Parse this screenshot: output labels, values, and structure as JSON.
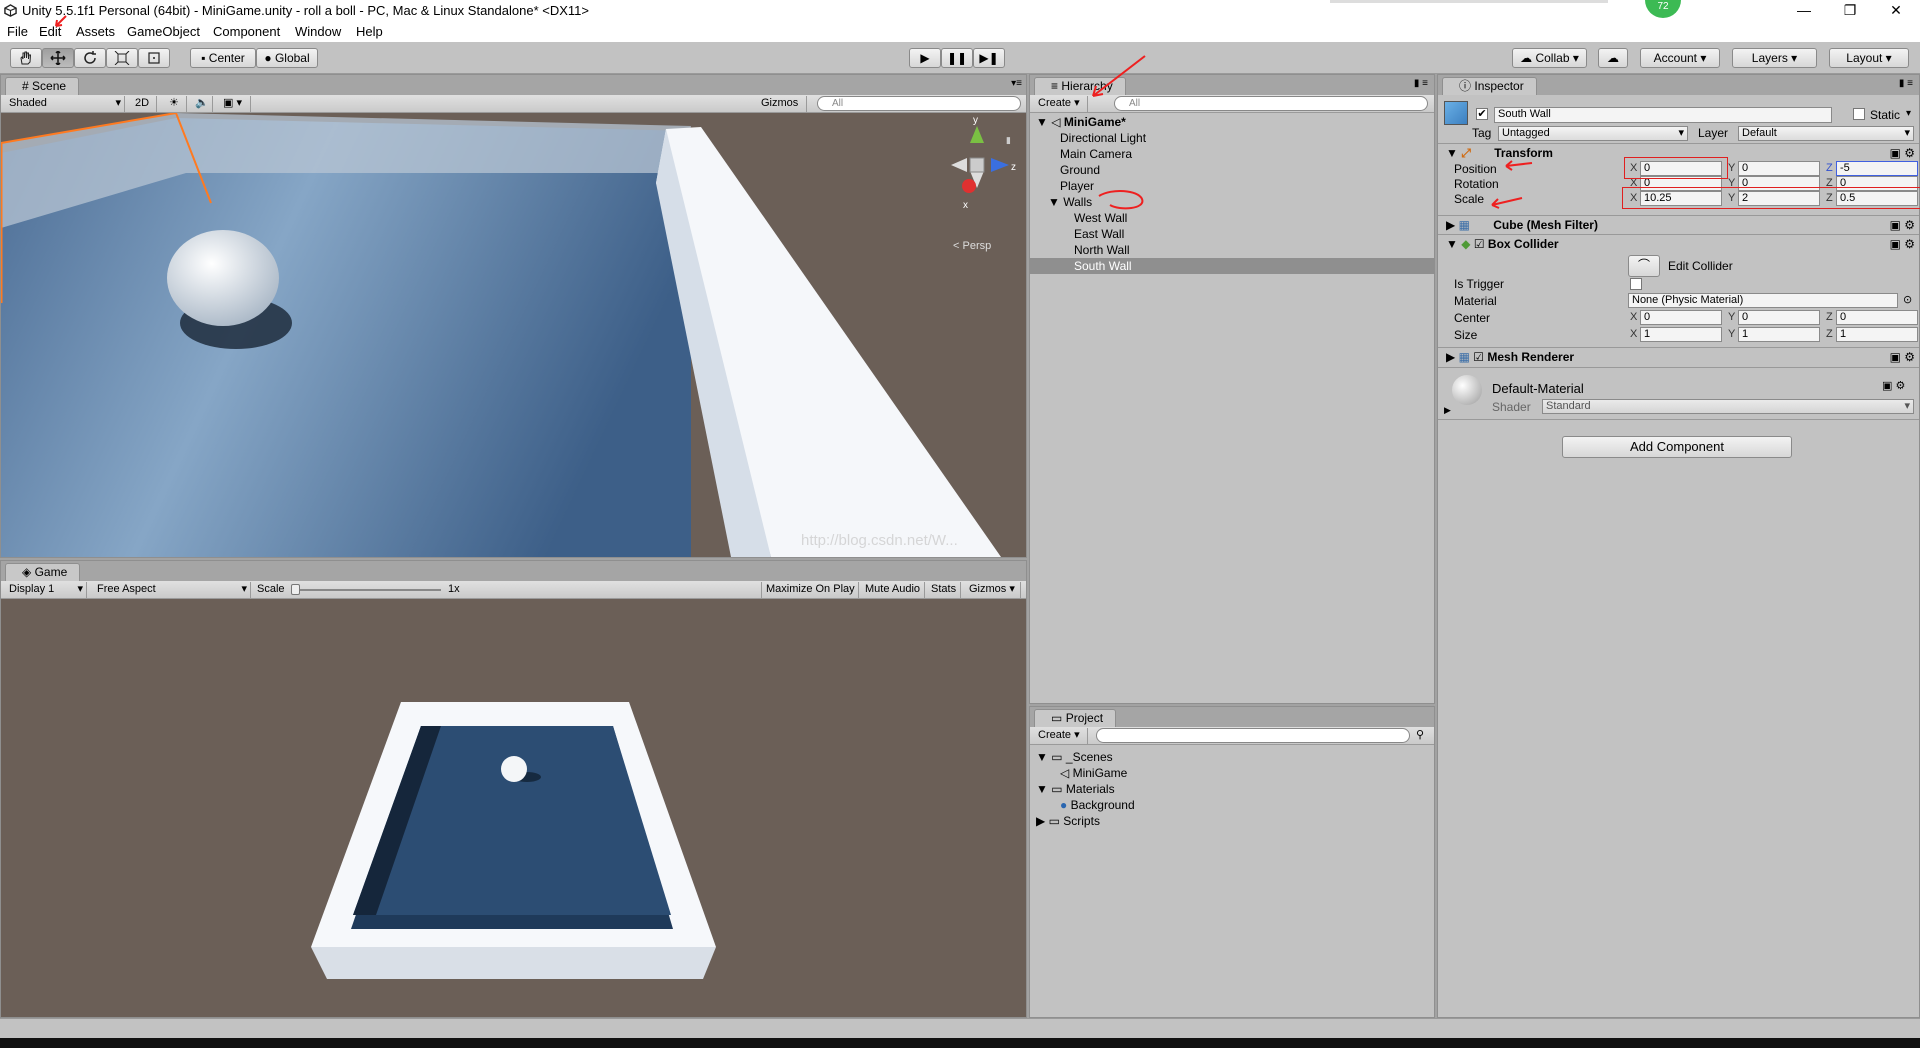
{
  "window": {
    "title": "Unity 5.5.1f1 Personal (64bit) - MiniGame.unity - roll a boll - PC, Mac & Linux Standalone* <DX11>",
    "notification_badge": "72",
    "minimize": "—",
    "maximize": "❐",
    "close": "✕"
  },
  "menu": [
    "File",
    "Edit",
    "Assets",
    "GameObject",
    "Component",
    "Window",
    "Help"
  ],
  "toolbar": {
    "pivot": "Center",
    "space": "Global",
    "collab": "Collab",
    "account": "Account",
    "layers": "Layers",
    "layout": "Layout"
  },
  "scene": {
    "tab": "Scene",
    "shading": "Shaded",
    "mode_2d": "2D",
    "gizmos": "Gizmos",
    "search_placeholder": "All",
    "persp": "Persp",
    "axis_x": "x",
    "axis_y": "y",
    "axis_z": "z",
    "watermark": "http://blog.csdn.net/W..."
  },
  "game": {
    "tab": "Game",
    "display": "Display 1",
    "aspect": "Free Aspect",
    "scale_label": "Scale",
    "scale_value": "1x",
    "maximize": "Maximize On Play",
    "mute": "Mute Audio",
    "stats": "Stats",
    "gizmos": "Gizmos"
  },
  "hierarchy": {
    "tab": "Hierarchy",
    "create": "Create",
    "search_placeholder": "All",
    "scene_name": "MiniGame*",
    "items": [
      {
        "label": "Directional Light"
      },
      {
        "label": "Main Camera"
      },
      {
        "label": "Ground"
      },
      {
        "label": "Player"
      },
      {
        "label": "Walls"
      },
      {
        "label": "West Wall"
      },
      {
        "label": "East Wall"
      },
      {
        "label": "North Wall"
      },
      {
        "label": "South Wall"
      }
    ]
  },
  "project": {
    "tab": "Project",
    "create": "Create",
    "items": [
      {
        "label": "_Scenes"
      },
      {
        "label": "MiniGame"
      },
      {
        "label": "Materials"
      },
      {
        "label": "Background"
      },
      {
        "label": "Scripts"
      }
    ]
  },
  "inspector": {
    "tab": "Inspector",
    "object_name": "South Wall",
    "static_label": "Static",
    "tag_label": "Tag",
    "tag_value": "Untagged",
    "layer_label": "Layer",
    "layer_value": "Default",
    "transform": {
      "title": "Transform",
      "position_label": "Position",
      "rotation_label": "Rotation",
      "scale_label": "Scale",
      "position": {
        "x": "0",
        "y": "0",
        "z": "-5"
      },
      "rotation": {
        "x": "0",
        "y": "0",
        "z": "0"
      },
      "scale": {
        "x": "10.25",
        "y": "2",
        "z": "0.5"
      }
    },
    "mesh_filter": "Cube (Mesh Filter)",
    "box_collider": {
      "title": "Box Collider",
      "edit_collider": "Edit Collider",
      "is_trigger": "Is Trigger",
      "material_label": "Material",
      "material_value": "None (Physic Material)",
      "center_label": "Center",
      "size_label": "Size",
      "center": {
        "x": "0",
        "y": "0",
        "z": "0"
      },
      "size": {
        "x": "1",
        "y": "1",
        "z": "1"
      }
    },
    "mesh_renderer": "Mesh Renderer",
    "material_name": "Default-Material",
    "shader_label": "Shader",
    "shader_value": "Standard",
    "add_component": "Add Component",
    "axis_x": "X",
    "axis_y": "Y",
    "axis_z": "Z"
  },
  "colors": {
    "panel": "#c2c2c2",
    "scene_bg": "#6b5f57",
    "floor": "#5b7ea8",
    "annotation": "#ee2020"
  }
}
